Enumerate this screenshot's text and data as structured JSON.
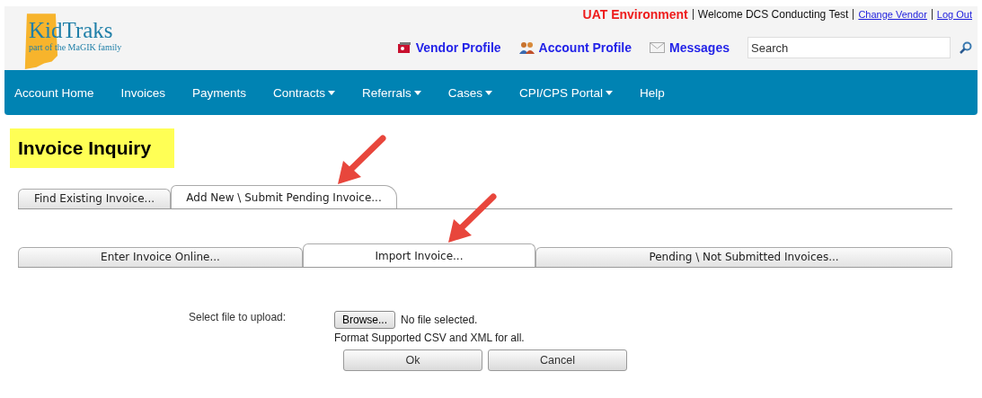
{
  "header": {
    "logo": {
      "name": "KidTraks",
      "tagline": "part of the MaGIK family"
    },
    "environment": "UAT Environment",
    "welcome": "Welcome DCS Conducting Test",
    "links": [
      "Change Vendor",
      "Log Out"
    ],
    "profile_links": [
      {
        "kind": "vendor",
        "label": "Vendor Profile"
      },
      {
        "kind": "account",
        "label": "Account Profile"
      },
      {
        "kind": "messages",
        "label": "Messages"
      }
    ],
    "search": {
      "placeholder": "Search"
    }
  },
  "nav": [
    {
      "label": "Account Home",
      "dropdown": false
    },
    {
      "label": "Invoices",
      "dropdown": false
    },
    {
      "label": "Payments",
      "dropdown": false
    },
    {
      "label": "Contracts",
      "dropdown": true
    },
    {
      "label": "Referrals",
      "dropdown": true
    },
    {
      "label": "Cases",
      "dropdown": true
    },
    {
      "label": "CPI/CPS Portal",
      "dropdown": true
    },
    {
      "label": "Help",
      "dropdown": false
    }
  ],
  "page_title": "Invoice Inquiry",
  "tabs": [
    {
      "label": "Find Existing Invoice...",
      "selected": false
    },
    {
      "label": "Add New \\ Submit Pending Invoice...",
      "selected": true
    }
  ],
  "subtabs": [
    {
      "label": "Enter Invoice Online...",
      "selected": false
    },
    {
      "label": "Import Invoice...",
      "selected": true
    },
    {
      "label": "Pending \\ Not Submitted Invoices...",
      "selected": false
    }
  ],
  "upload": {
    "label": "Select file to upload:",
    "browse": "Browse...",
    "file_status": "No file selected.",
    "hint": "Format Supported CSV and XML for all."
  },
  "buttons": [
    "Ok",
    "Cancel"
  ]
}
